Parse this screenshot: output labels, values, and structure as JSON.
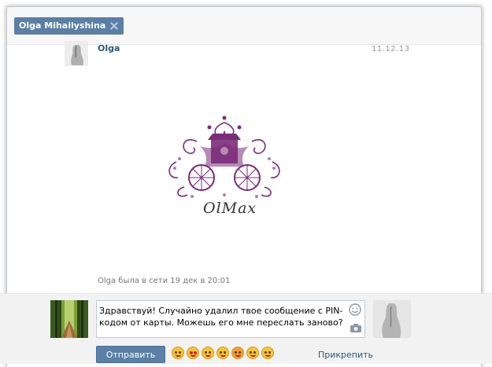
{
  "header": {
    "tab_label": "Olga Mihailyshina"
  },
  "message": {
    "author": "Olga",
    "date": "11.12.13",
    "logo_text": "OlMax",
    "status": "Olga была в сети 19 дек в 20:01"
  },
  "composer": {
    "input_value": "Здравствуй! Случайно удалил твое сообщение с PIN-кодом от карты. Можешь его мне переслать заново?",
    "send_label": "Отправить",
    "attach_label": "Прикрепить",
    "emojis": [
      "wink-tongue-emoji-icon",
      "heart-eyes-emoji-icon",
      "smile-emoji-icon",
      "wink-emoji-icon",
      "surprised-emoji-icon",
      "thinking-emoji-icon",
      "laughing-emoji-icon"
    ]
  },
  "colors": {
    "accent": "#5b7fa6",
    "link": "#2b587a",
    "logo": "#7a2c78"
  }
}
